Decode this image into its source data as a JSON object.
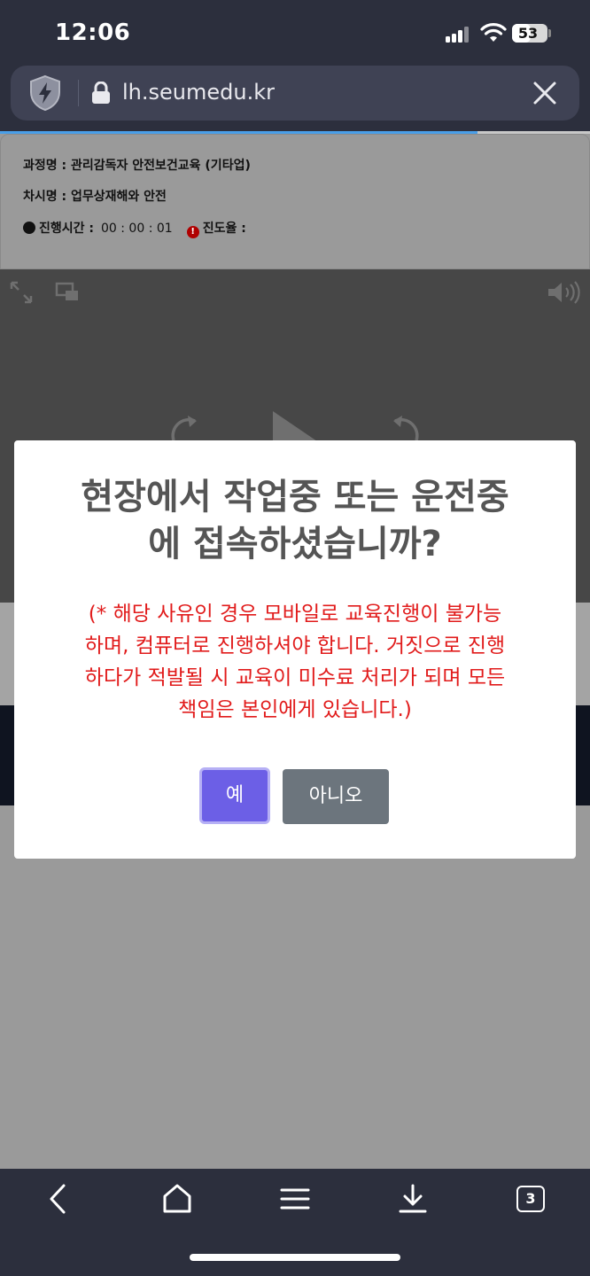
{
  "status_bar": {
    "time": "12:06",
    "battery_level": "53"
  },
  "browser": {
    "url": "lh.seumedu.kr",
    "page_progress_fraction": 0.81
  },
  "course": {
    "course_label": "과정명 : 관리감독자 안전보건교육 (기타업)",
    "session_label": "차시명 : 업무상재해와 안전",
    "elapsed_label": "진행시간 :",
    "elapsed_value": "00 : 00 : 01",
    "progress_label": "진도율 :"
  },
  "modal": {
    "title_line1": "현장에서 작업중 또는 운전중",
    "title_line2": "에 접속하셨습니까?",
    "warning_line1": "(* 해당 사유인 경우 모바일로 교육진행이 불가능",
    "warning_line2": "하며, 컴퓨터로 진행하셔야 합니다. 거짓으로 진행",
    "warning_line3": "하다가 적발될 시 교육이 미수료 처리가 되며 모든",
    "warning_line4": "책임은 본인에게 있습니다.)",
    "yes_label": "예",
    "no_label": "아니오"
  },
  "toolbar": {
    "tabs_count": "3"
  },
  "colors": {
    "chrome_bg": "#2c2f3d",
    "url_pill": "#3f4254",
    "accent_yes": "#6c5fe6",
    "button_no": "#6c757d",
    "warning_text": "#e11b1b",
    "progress_blue": "#4a9fe8"
  }
}
